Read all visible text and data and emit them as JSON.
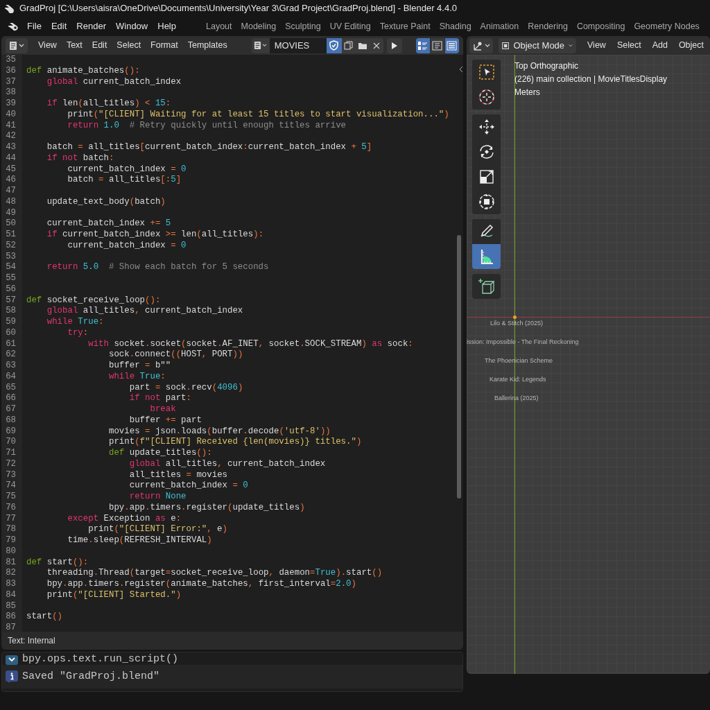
{
  "window": {
    "title": "GradProj [C:\\Users\\aisra\\OneDrive\\Documents\\University\\Year 3\\Grad Project\\GradProj.blend] - Blender 4.4.0"
  },
  "menu_bar": [
    "File",
    "Edit",
    "Render",
    "Window",
    "Help"
  ],
  "workspace_tabs": [
    "Layout",
    "Modeling",
    "Sculpting",
    "UV Editing",
    "Texture Paint",
    "Shading",
    "Animation",
    "Rendering",
    "Compositing",
    "Geometry Nodes"
  ],
  "text_editor": {
    "menus": [
      "View",
      "Text",
      "Edit",
      "Select",
      "Format",
      "Templates"
    ],
    "text_name": "MOVIES",
    "fake_user": true,
    "toggles": [
      {
        "kind": "line_numbers",
        "on": true
      },
      {
        "kind": "word_wrap",
        "on": false
      },
      {
        "kind": "syntax_highlight",
        "on": true
      }
    ],
    "lines": [
      {
        "number": "35"
      },
      {
        "number": "36",
        "tokens": [
          {
            "kind": "def",
            "text": "def"
          },
          {
            "kind": "name",
            "text": " animate_batches"
          },
          {
            "kind": "operator",
            "text": "():"
          }
        ]
      },
      {
        "number": "37",
        "tokens": [
          {
            "kind": "keyword",
            "text": "    global"
          },
          {
            "kind": "name",
            "text": " current_batch_index"
          }
        ]
      },
      {
        "number": "38"
      },
      {
        "number": "39",
        "tokens": [
          {
            "kind": "keyword",
            "text": "    if"
          },
          {
            "kind": "name",
            "text": " len"
          },
          {
            "kind": "operator",
            "text": "("
          },
          {
            "kind": "name",
            "text": "all_titles"
          },
          {
            "kind": "operator",
            "text": ") <"
          },
          {
            "kind": "number",
            "text": " 15"
          },
          {
            "kind": "operator",
            "text": ":"
          }
        ]
      },
      {
        "number": "40",
        "tokens": [
          {
            "kind": "name",
            "text": "        print"
          },
          {
            "kind": "operator",
            "text": "("
          },
          {
            "kind": "string",
            "text": "\"[CLIENT] Waiting for at least 15 titles to start visualization...\""
          },
          {
            "kind": "operator",
            "text": ")"
          }
        ]
      },
      {
        "number": "41",
        "tokens": [
          {
            "kind": "keyword",
            "text": "        return"
          },
          {
            "kind": "number",
            "text": " 1.0"
          },
          {
            "kind": "comment",
            "text": "  # Retry quickly until enough titles arrive"
          }
        ]
      },
      {
        "number": "42"
      },
      {
        "number": "43",
        "tokens": [
          {
            "kind": "name",
            "text": "    batch"
          },
          {
            "kind": "operator",
            "text": " ="
          },
          {
            "kind": "name",
            "text": " all_titles"
          },
          {
            "kind": "operator",
            "text": "["
          },
          {
            "kind": "name",
            "text": "current_batch_index"
          },
          {
            "kind": "operator",
            "text": ":"
          },
          {
            "kind": "name",
            "text": "current_batch_index"
          },
          {
            "kind": "operator",
            "text": " +"
          },
          {
            "kind": "number",
            "text": " 5"
          },
          {
            "kind": "operator",
            "text": "]"
          }
        ]
      },
      {
        "number": "44",
        "tokens": [
          {
            "kind": "keyword",
            "text": "    if not"
          },
          {
            "kind": "name",
            "text": " batch"
          },
          {
            "kind": "operator",
            "text": ":"
          }
        ]
      },
      {
        "number": "45",
        "tokens": [
          {
            "kind": "name",
            "text": "        current_batch_index"
          },
          {
            "kind": "operator",
            "text": " ="
          },
          {
            "kind": "number",
            "text": " 0"
          }
        ]
      },
      {
        "number": "46",
        "tokens": [
          {
            "kind": "name",
            "text": "        batch"
          },
          {
            "kind": "operator",
            "text": " ="
          },
          {
            "kind": "name",
            "text": " all_titles"
          },
          {
            "kind": "operator",
            "text": "[:"
          },
          {
            "kind": "number",
            "text": "5"
          },
          {
            "kind": "operator",
            "text": "]"
          }
        ]
      },
      {
        "number": "47"
      },
      {
        "number": "48",
        "tokens": [
          {
            "kind": "name",
            "text": "    update_text_body"
          },
          {
            "kind": "operator",
            "text": "("
          },
          {
            "kind": "name",
            "text": "batch"
          },
          {
            "kind": "operator",
            "text": ")"
          }
        ]
      },
      {
        "number": "49"
      },
      {
        "number": "50",
        "tokens": [
          {
            "kind": "name",
            "text": "    current_batch_index"
          },
          {
            "kind": "operator",
            "text": " +="
          },
          {
            "kind": "number",
            "text": " 5"
          }
        ]
      },
      {
        "number": "51",
        "tokens": [
          {
            "kind": "keyword",
            "text": "    if"
          },
          {
            "kind": "name",
            "text": " current_batch_index"
          },
          {
            "kind": "operator",
            "text": " >="
          },
          {
            "kind": "name",
            "text": " len"
          },
          {
            "kind": "operator",
            "text": "("
          },
          {
            "kind": "name",
            "text": "all_titles"
          },
          {
            "kind": "operator",
            "text": "):"
          }
        ]
      },
      {
        "number": "52",
        "tokens": [
          {
            "kind": "name",
            "text": "        current_batch_index"
          },
          {
            "kind": "operator",
            "text": " ="
          },
          {
            "kind": "number",
            "text": " 0"
          }
        ]
      },
      {
        "number": "53"
      },
      {
        "number": "54",
        "tokens": [
          {
            "kind": "keyword",
            "text": "    return"
          },
          {
            "kind": "number",
            "text": " 5.0"
          },
          {
            "kind": "comment",
            "text": "  # Show each batch for 5 seconds"
          }
        ]
      },
      {
        "number": "55"
      },
      {
        "number": "56"
      },
      {
        "number": "57",
        "tokens": [
          {
            "kind": "def",
            "text": "def"
          },
          {
            "kind": "name",
            "text": " socket_receive_loop"
          },
          {
            "kind": "operator",
            "text": "():"
          }
        ]
      },
      {
        "number": "58",
        "tokens": [
          {
            "kind": "keyword",
            "text": "    global"
          },
          {
            "kind": "name",
            "text": " all_titles"
          },
          {
            "kind": "operator",
            "text": ","
          },
          {
            "kind": "name",
            "text": " current_batch_index"
          }
        ]
      },
      {
        "number": "59",
        "tokens": [
          {
            "kind": "keyword",
            "text": "    while"
          },
          {
            "kind": "number",
            "text": " True"
          },
          {
            "kind": "operator",
            "text": ":"
          }
        ]
      },
      {
        "number": "60",
        "tokens": [
          {
            "kind": "keyword",
            "text": "        try"
          },
          {
            "kind": "operator",
            "text": ":"
          }
        ]
      },
      {
        "number": "61",
        "tokens": [
          {
            "kind": "keyword",
            "text": "            with"
          },
          {
            "kind": "name",
            "text": " socket"
          },
          {
            "kind": "operator",
            "text": "."
          },
          {
            "kind": "name",
            "text": "socket"
          },
          {
            "kind": "operator",
            "text": "("
          },
          {
            "kind": "name",
            "text": "socket"
          },
          {
            "kind": "operator",
            "text": "."
          },
          {
            "kind": "name",
            "text": "AF_INET"
          },
          {
            "kind": "operator",
            "text": ","
          },
          {
            "kind": "name",
            "text": " socket"
          },
          {
            "kind": "operator",
            "text": "."
          },
          {
            "kind": "name",
            "text": "SOCK_STREAM"
          },
          {
            "kind": "operator",
            "text": ")"
          },
          {
            "kind": "keyword",
            "text": " as"
          },
          {
            "kind": "name",
            "text": " sock"
          },
          {
            "kind": "operator",
            "text": ":"
          }
        ]
      },
      {
        "number": "62",
        "tokens": [
          {
            "kind": "name",
            "text": "                sock"
          },
          {
            "kind": "operator",
            "text": "."
          },
          {
            "kind": "name",
            "text": "connect"
          },
          {
            "kind": "operator",
            "text": "(("
          },
          {
            "kind": "name",
            "text": "HOST"
          },
          {
            "kind": "operator",
            "text": ","
          },
          {
            "kind": "name",
            "text": " PORT"
          },
          {
            "kind": "operator",
            "text": "))"
          }
        ]
      },
      {
        "number": "63",
        "tokens": [
          {
            "kind": "name",
            "text": "                buffer"
          },
          {
            "kind": "operator",
            "text": " ="
          },
          {
            "kind": "name",
            "text": " b\"\""
          }
        ]
      },
      {
        "number": "64",
        "tokens": [
          {
            "kind": "keyword",
            "text": "                while"
          },
          {
            "kind": "number",
            "text": " True"
          },
          {
            "kind": "operator",
            "text": ":"
          }
        ]
      },
      {
        "number": "65",
        "tokens": [
          {
            "kind": "name",
            "text": "                    part"
          },
          {
            "kind": "operator",
            "text": " ="
          },
          {
            "kind": "name",
            "text": " sock"
          },
          {
            "kind": "operator",
            "text": "."
          },
          {
            "kind": "name",
            "text": "recv"
          },
          {
            "kind": "operator",
            "text": "("
          },
          {
            "kind": "number",
            "text": "4096"
          },
          {
            "kind": "operator",
            "text": ")"
          }
        ]
      },
      {
        "number": "66",
        "tokens": [
          {
            "kind": "keyword",
            "text": "                    if not"
          },
          {
            "kind": "name",
            "text": " part"
          },
          {
            "kind": "operator",
            "text": ":"
          }
        ]
      },
      {
        "number": "67",
        "tokens": [
          {
            "kind": "keyword",
            "text": "                        break"
          }
        ]
      },
      {
        "number": "68",
        "tokens": [
          {
            "kind": "name",
            "text": "                    buffer"
          },
          {
            "kind": "operator",
            "text": " +="
          },
          {
            "kind": "name",
            "text": " part"
          }
        ]
      },
      {
        "number": "69",
        "tokens": [
          {
            "kind": "name",
            "text": "                movies"
          },
          {
            "kind": "operator",
            "text": " ="
          },
          {
            "kind": "name",
            "text": " json"
          },
          {
            "kind": "operator",
            "text": "."
          },
          {
            "kind": "name",
            "text": "loads"
          },
          {
            "kind": "operator",
            "text": "("
          },
          {
            "kind": "name",
            "text": "buffer"
          },
          {
            "kind": "operator",
            "text": "."
          },
          {
            "kind": "name",
            "text": "decode"
          },
          {
            "kind": "operator",
            "text": "("
          },
          {
            "kind": "string",
            "text": "'utf-8'"
          },
          {
            "kind": "operator",
            "text": "))"
          }
        ]
      },
      {
        "number": "70",
        "tokens": [
          {
            "kind": "name",
            "text": "                print"
          },
          {
            "kind": "operator",
            "text": "("
          },
          {
            "kind": "string",
            "text": "f\"[CLIENT] Received {len(movies)} titles.\""
          },
          {
            "kind": "operator",
            "text": ")"
          }
        ]
      },
      {
        "number": "71",
        "tokens": [
          {
            "kind": "def",
            "text": "                def"
          },
          {
            "kind": "name",
            "text": " update_titles"
          },
          {
            "kind": "operator",
            "text": "():"
          }
        ]
      },
      {
        "number": "72",
        "tokens": [
          {
            "kind": "keyword",
            "text": "                    global"
          },
          {
            "kind": "name",
            "text": " all_titles"
          },
          {
            "kind": "operator",
            "text": ","
          },
          {
            "kind": "name",
            "text": " current_batch_index"
          }
        ]
      },
      {
        "number": "73",
        "tokens": [
          {
            "kind": "name",
            "text": "                    all_titles"
          },
          {
            "kind": "operator",
            "text": " ="
          },
          {
            "kind": "name",
            "text": " movies"
          }
        ]
      },
      {
        "number": "74",
        "tokens": [
          {
            "kind": "name",
            "text": "                    current_batch_index"
          },
          {
            "kind": "operator",
            "text": " ="
          },
          {
            "kind": "number",
            "text": " 0"
          }
        ]
      },
      {
        "number": "75",
        "tokens": [
          {
            "kind": "keyword",
            "text": "                    return"
          },
          {
            "kind": "number",
            "text": " None"
          }
        ]
      },
      {
        "number": "76",
        "tokens": [
          {
            "kind": "name",
            "text": "                bpy"
          },
          {
            "kind": "operator",
            "text": "."
          },
          {
            "kind": "name",
            "text": "app"
          },
          {
            "kind": "operator",
            "text": "."
          },
          {
            "kind": "name",
            "text": "timers"
          },
          {
            "kind": "operator",
            "text": "."
          },
          {
            "kind": "name",
            "text": "register"
          },
          {
            "kind": "operator",
            "text": "("
          },
          {
            "kind": "name",
            "text": "update_titles"
          },
          {
            "kind": "operator",
            "text": ")"
          }
        ]
      },
      {
        "number": "77",
        "tokens": [
          {
            "kind": "keyword",
            "text": "        except"
          },
          {
            "kind": "name",
            "text": " Exception"
          },
          {
            "kind": "keyword",
            "text": " as"
          },
          {
            "kind": "name",
            "text": " e"
          },
          {
            "kind": "operator",
            "text": ":"
          }
        ]
      },
      {
        "number": "78",
        "tokens": [
          {
            "kind": "name",
            "text": "            print"
          },
          {
            "kind": "operator",
            "text": "("
          },
          {
            "kind": "string",
            "text": "\"[CLIENT] Error:\""
          },
          {
            "kind": "operator",
            "text": ","
          },
          {
            "kind": "name",
            "text": " e"
          },
          {
            "kind": "operator",
            "text": ")"
          }
        ]
      },
      {
        "number": "79",
        "tokens": [
          {
            "kind": "name",
            "text": "        time"
          },
          {
            "kind": "operator",
            "text": "."
          },
          {
            "kind": "name",
            "text": "sleep"
          },
          {
            "kind": "operator",
            "text": "("
          },
          {
            "kind": "name",
            "text": "REFRESH_INTERVAL"
          },
          {
            "kind": "operator",
            "text": ")"
          }
        ]
      },
      {
        "number": "80"
      },
      {
        "number": "81",
        "tokens": [
          {
            "kind": "def",
            "text": "def"
          },
          {
            "kind": "name",
            "text": " start"
          },
          {
            "kind": "operator",
            "text": "():"
          }
        ]
      },
      {
        "number": "82",
        "tokens": [
          {
            "kind": "name",
            "text": "    threading"
          },
          {
            "kind": "operator",
            "text": "."
          },
          {
            "kind": "name",
            "text": "Thread"
          },
          {
            "kind": "operator",
            "text": "("
          },
          {
            "kind": "name",
            "text": "target"
          },
          {
            "kind": "operator",
            "text": "="
          },
          {
            "kind": "name",
            "text": "socket_receive_loop"
          },
          {
            "kind": "operator",
            "text": ","
          },
          {
            "kind": "name",
            "text": " daemon"
          },
          {
            "kind": "operator",
            "text": "="
          },
          {
            "kind": "number",
            "text": "True"
          },
          {
            "kind": "operator",
            "text": ")."
          },
          {
            "kind": "name",
            "text": "start"
          },
          {
            "kind": "operator",
            "text": "()"
          }
        ]
      },
      {
        "number": "83",
        "tokens": [
          {
            "kind": "name",
            "text": "    bpy"
          },
          {
            "kind": "operator",
            "text": "."
          },
          {
            "kind": "name",
            "text": "app"
          },
          {
            "kind": "operator",
            "text": "."
          },
          {
            "kind": "name",
            "text": "timers"
          },
          {
            "kind": "operator",
            "text": "."
          },
          {
            "kind": "name",
            "text": "register"
          },
          {
            "kind": "operator",
            "text": "("
          },
          {
            "kind": "name",
            "text": "animate_batches"
          },
          {
            "kind": "operator",
            "text": ","
          },
          {
            "kind": "name",
            "text": " first_interval"
          },
          {
            "kind": "operator",
            "text": "="
          },
          {
            "kind": "number",
            "text": "2.0"
          },
          {
            "kind": "operator",
            "text": ")"
          }
        ]
      },
      {
        "number": "84",
        "tokens": [
          {
            "kind": "name",
            "text": "    print"
          },
          {
            "kind": "operator",
            "text": "("
          },
          {
            "kind": "string",
            "text": "\"[CLIENT] Started.\""
          },
          {
            "kind": "operator",
            "text": ")"
          }
        ]
      },
      {
        "number": "85"
      },
      {
        "number": "86",
        "tokens": [
          {
            "kind": "name",
            "text": "start"
          },
          {
            "kind": "operator",
            "text": "()"
          }
        ]
      },
      {
        "number": "87"
      }
    ],
    "footer": "Text: Internal"
  },
  "info_log": [
    {
      "kind": "operator",
      "text": "bpy.ops.text.run_script()"
    },
    {
      "kind": "info",
      "text": "Saved \"GradProj.blend\""
    }
  ],
  "viewport": {
    "mode": "Object Mode",
    "menus": [
      "View",
      "Select",
      "Add",
      "Object"
    ],
    "overlay": [
      "Top Orthographic",
      "(226) main collection | MovieTitlesDisplay",
      "Meters"
    ],
    "tool_groups": [
      [
        {
          "kind": "select_box",
          "selected": false
        },
        {
          "kind": "cursor",
          "selected": false
        }
      ],
      [
        {
          "kind": "move",
          "selected": false
        },
        {
          "kind": "rotate",
          "selected": false
        },
        {
          "kind": "scale",
          "selected": false
        },
        {
          "kind": "transform",
          "selected": false
        }
      ],
      [
        {
          "kind": "annotate",
          "selected": false
        },
        {
          "kind": "measure",
          "selected": true
        }
      ],
      [
        {
          "kind": "add_cube",
          "selected": false
        }
      ]
    ],
    "scene_texts": [
      "Lilo & Stitch (2025)",
      "ission: Impossible - The Final Reckoning",
      "The Phoenician Scheme",
      "Karate Kid: Legends",
      "Ballerina (2025)"
    ]
  }
}
